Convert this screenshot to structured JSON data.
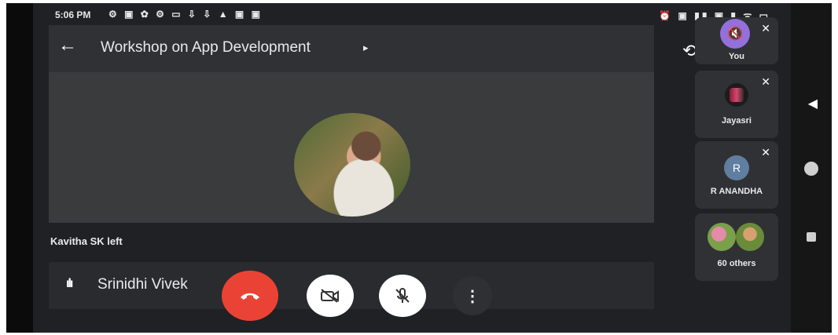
{
  "status": {
    "time": "5:06 PM",
    "left_icons": "⚙ ▣ ✿ ⚙ ▭ ⇩ ⇩ ▲ ▣ ▣",
    "right_icons": "⏰ ▣ ▮▮ ▣ ▮ ᯤ ▭"
  },
  "call": {
    "title": "Workshop on App Development",
    "event_message": "Kavitha SK left",
    "active_speaker": "Srinidhi Vivek"
  },
  "participants": [
    {
      "label": "You",
      "muted": true
    },
    {
      "label": "Jayasri",
      "muted": true
    },
    {
      "label": "R ANANDHA",
      "initial": "R",
      "muted": true
    },
    {
      "label": "60 others"
    }
  ],
  "icons": {
    "back": "arrow-left-icon",
    "flip_camera": "flip-camera-icon",
    "end_call": "phone-hangup-icon",
    "camera_off": "camera-off-icon",
    "mic_off": "mic-off-icon",
    "more": "more-vert-icon"
  },
  "colors": {
    "end_call": "#ea4335",
    "background": "#202124",
    "you_avatar": "#9370db"
  }
}
